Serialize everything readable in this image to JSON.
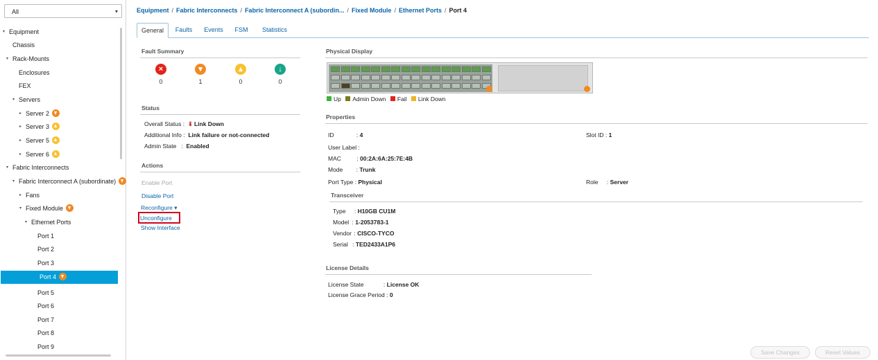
{
  "filter": {
    "value": "All"
  },
  "tree": [
    {
      "label": "Equipment",
      "twisty": "▾"
    },
    {
      "label": "Chassis",
      "twisty": ""
    },
    {
      "label": "Rack-Mounts",
      "twisty": "▾"
    },
    {
      "label": "Enclosures",
      "twisty": ""
    },
    {
      "label": "FEX",
      "twisty": ""
    },
    {
      "label": "Servers",
      "twisty": "▾"
    },
    {
      "label": "Server 2",
      "twisty": "▸",
      "badge": "major"
    },
    {
      "label": "Server 3",
      "twisty": "▸",
      "badge": "minor"
    },
    {
      "label": "Server 5",
      "twisty": "▸",
      "badge": "minor"
    },
    {
      "label": "Server 6",
      "twisty": "▸",
      "badge": "minor"
    },
    {
      "label": "Fabric Interconnects",
      "twisty": "▾"
    },
    {
      "label": "Fabric Interconnect A (subordinate)",
      "twisty": "▾",
      "badge": "major"
    },
    {
      "label": "Fans",
      "twisty": "▸"
    },
    {
      "label": "Fixed Module",
      "twisty": "▾",
      "badge": "major"
    },
    {
      "label": "Ethernet Ports",
      "twisty": "▾"
    },
    {
      "label": "Port 1",
      "twisty": ""
    },
    {
      "label": "Port 2",
      "twisty": ""
    },
    {
      "label": "Port 3",
      "twisty": ""
    },
    {
      "label": "Port 4",
      "twisty": "",
      "badge": "major",
      "selected": true
    },
    {
      "label": "Port 5",
      "twisty": ""
    },
    {
      "label": "Port 6",
      "twisty": ""
    },
    {
      "label": "Port 7",
      "twisty": ""
    },
    {
      "label": "Port 8",
      "twisty": ""
    },
    {
      "label": "Port 9",
      "twisty": ""
    }
  ],
  "breadcrumb": [
    "Equipment",
    "Fabric Interconnects",
    "Fabric Interconnect A (subordin...",
    "Fixed Module",
    "Ethernet Ports",
    "Port 4"
  ],
  "tabs": [
    "General",
    "Faults",
    "Events",
    "FSM",
    "Statistics"
  ],
  "fault_summary": {
    "title": "Fault Summary",
    "counts": [
      {
        "severity": "critical",
        "icon": "critical-x-icon",
        "count": "0"
      },
      {
        "severity": "major",
        "icon": "major-chevron-icon",
        "count": "1"
      },
      {
        "severity": "minor",
        "icon": "minor-warning-icon",
        "count": "0"
      },
      {
        "severity": "warning",
        "icon": "info-arrow-icon",
        "count": "0"
      }
    ]
  },
  "status": {
    "title": "Status",
    "overall_label": "Overall Status :",
    "overall_value": "Link Down",
    "additional_label": "Additional Info :",
    "additional_value": "Link failure or not-connected",
    "admin_label": "Admin State",
    "admin_sep": ":",
    "admin_value": "Enabled"
  },
  "actions": {
    "title": "Actions",
    "enable": "Enable Port",
    "disable": "Disable Port",
    "reconfigure": "Reconfigure ▾",
    "unconfigure": "Unconfigure",
    "show_interface": "Show Interface"
  },
  "physical": {
    "title": "Physical Display",
    "legend": [
      {
        "label": "Up",
        "color": "#3cb43c"
      },
      {
        "label": "Admin Down",
        "color": "#7a7a1e"
      },
      {
        "label": "Fail",
        "color": "#e2231a"
      },
      {
        "label": "Link Down",
        "color": "#f0b323"
      }
    ]
  },
  "properties": {
    "title": "Properties",
    "id_label": "ID",
    "id_value": "4",
    "slot_label": "Slot ID :",
    "slot_value": "1",
    "user_label": "User Label :",
    "mac_label": "MAC",
    "mac_value": "00:2A:6A:25:7E:4B",
    "mode_label": "Mode",
    "mode_value": "Trunk",
    "port_type_label": "Port Type :",
    "port_type_value": "Physical",
    "role_label": "Role",
    "role_value": "Server",
    "sep": ":"
  },
  "transceiver": {
    "title": "Transceiver",
    "type_label": "Type",
    "type_value": "H10GB CU1M",
    "model_label": "Model",
    "model_value": "1-2053783-1",
    "vendor_label": "Vendor",
    "vendor_value": "CISCO-TYCO",
    "serial_label": "Serial",
    "serial_value": "TED2433A1P6"
  },
  "license": {
    "title": "License Details",
    "state_label": "License State",
    "state_value": "License OK",
    "grace_label": "License Grace Period :",
    "grace_value": "0"
  },
  "buttons": {
    "save": "Save Changes",
    "reset": "Reset Values"
  }
}
